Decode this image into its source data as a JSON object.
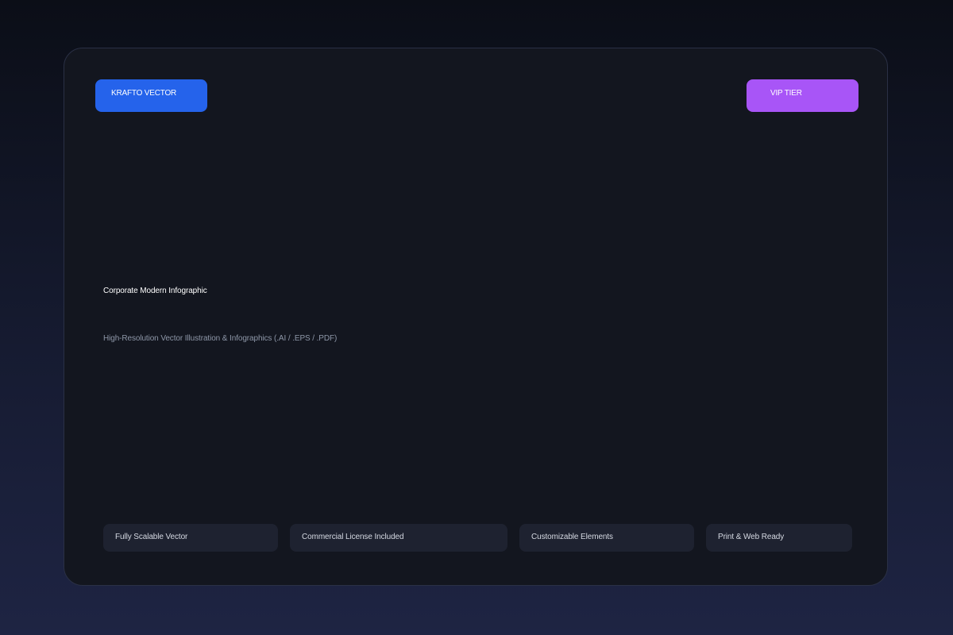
{
  "header": {
    "brand_label": "KRAFTO VECTOR",
    "tier_label": "VIP TIER"
  },
  "hero": {
    "title": "Corporate Modern Infographic",
    "subtitle": "High-Resolution Vector Illustration & Infographics (.AI / .EPS / .PDF)"
  },
  "features": [
    {
      "label": "Fully Scalable Vector"
    },
    {
      "label": "Commercial License Included"
    },
    {
      "label": "Customizable Elements"
    },
    {
      "label": "Print & Web Ready"
    }
  ],
  "colors": {
    "brand_badge": "#2563eb",
    "tier_badge": "#a855f7",
    "card_background": "#13161f",
    "feature_background": "#1e2230"
  }
}
